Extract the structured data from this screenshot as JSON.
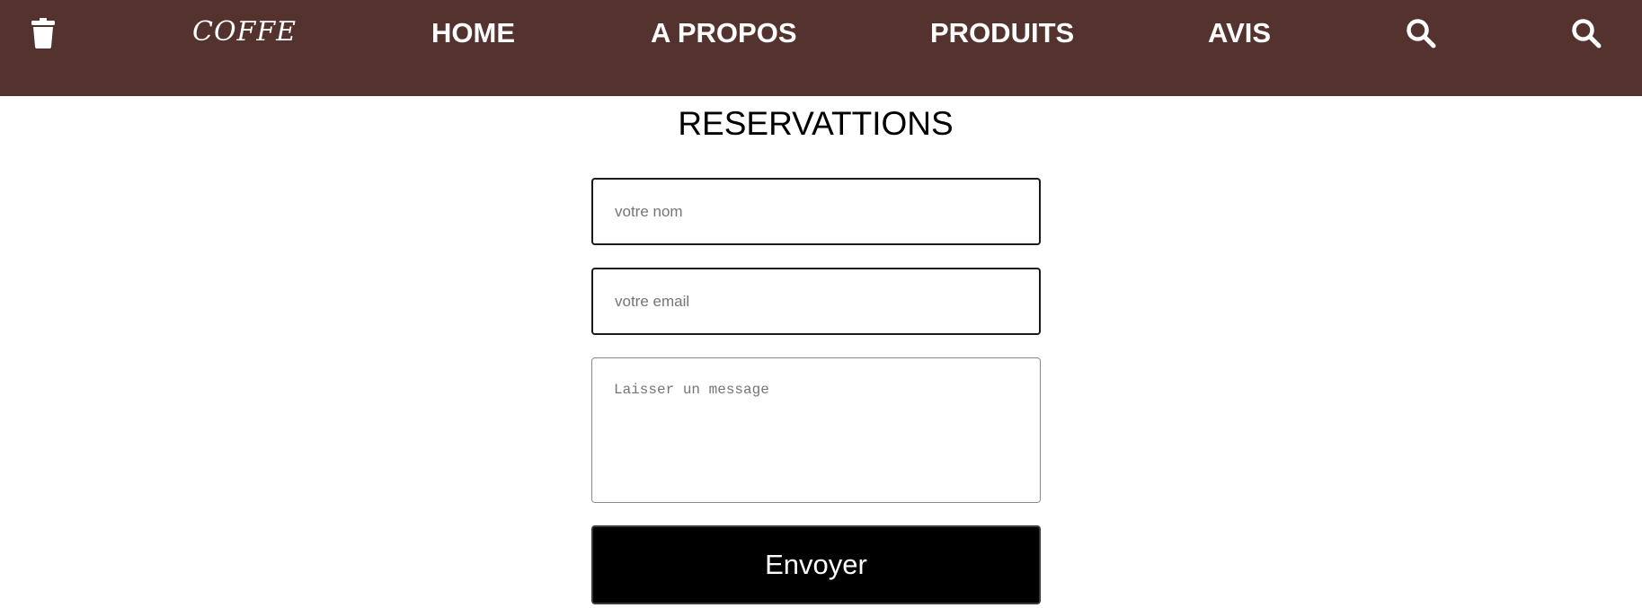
{
  "navbar": {
    "background": "#54322d",
    "cart_icon": "trash-can-icon",
    "logo": "COFFE",
    "links": [
      {
        "label": "HOME"
      },
      {
        "label": "A PROPOS"
      },
      {
        "label": "PRODUITS"
      },
      {
        "label": "AVIS"
      }
    ],
    "right_icons": [
      "search-icon",
      "search-icon"
    ]
  },
  "form": {
    "title": "RESERVATTIONS",
    "name_placeholder": "votre nom",
    "email_placeholder": "votre email",
    "message_placeholder": "Laisser un message",
    "submit_label": "Envoyer"
  },
  "colors": {
    "navbar_bg": "#54322d",
    "nav_text": "#ffffff",
    "button_bg": "#000000",
    "button_text": "#ffffff"
  }
}
